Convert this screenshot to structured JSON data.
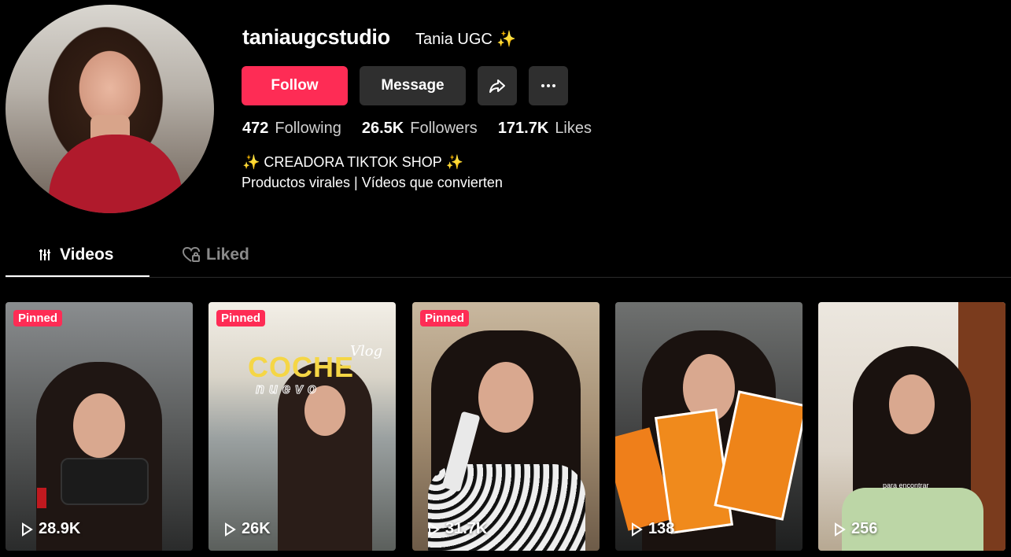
{
  "profile": {
    "username": "taniaugcstudio",
    "nickname": "Tania UGC ✨",
    "bio_line1": "✨ CREADORA TIKTOK SHOP ✨",
    "bio_line2": "Productos virales | Vídeos que convierten"
  },
  "actions": {
    "follow_label": "Follow",
    "message_label": "Message"
  },
  "stats": [
    {
      "value": "472",
      "label": "Following"
    },
    {
      "value": "26.5K",
      "label": "Followers"
    },
    {
      "value": "171.7K",
      "label": "Likes"
    }
  ],
  "tabs": [
    {
      "label": "Videos",
      "icon": "grid-icon",
      "active": true
    },
    {
      "label": "Liked",
      "icon": "heart-lock-icon",
      "active": false
    }
  ],
  "videos": [
    {
      "pinned": "Pinned",
      "views": "28.9K"
    },
    {
      "pinned": "Pinned",
      "views": "26K",
      "overlay": "COCHE",
      "overlay_sub": "nuevo",
      "overlay_script": "Vlog"
    },
    {
      "pinned": "Pinned",
      "views": "31.7K"
    },
    {
      "pinned": "",
      "views": "138"
    },
    {
      "pinned": "",
      "views": "256",
      "caption": "para encontrar"
    }
  ],
  "colors": {
    "accent": "#fe2c55",
    "button_dark": "#2f2f2f",
    "background": "#000000"
  }
}
